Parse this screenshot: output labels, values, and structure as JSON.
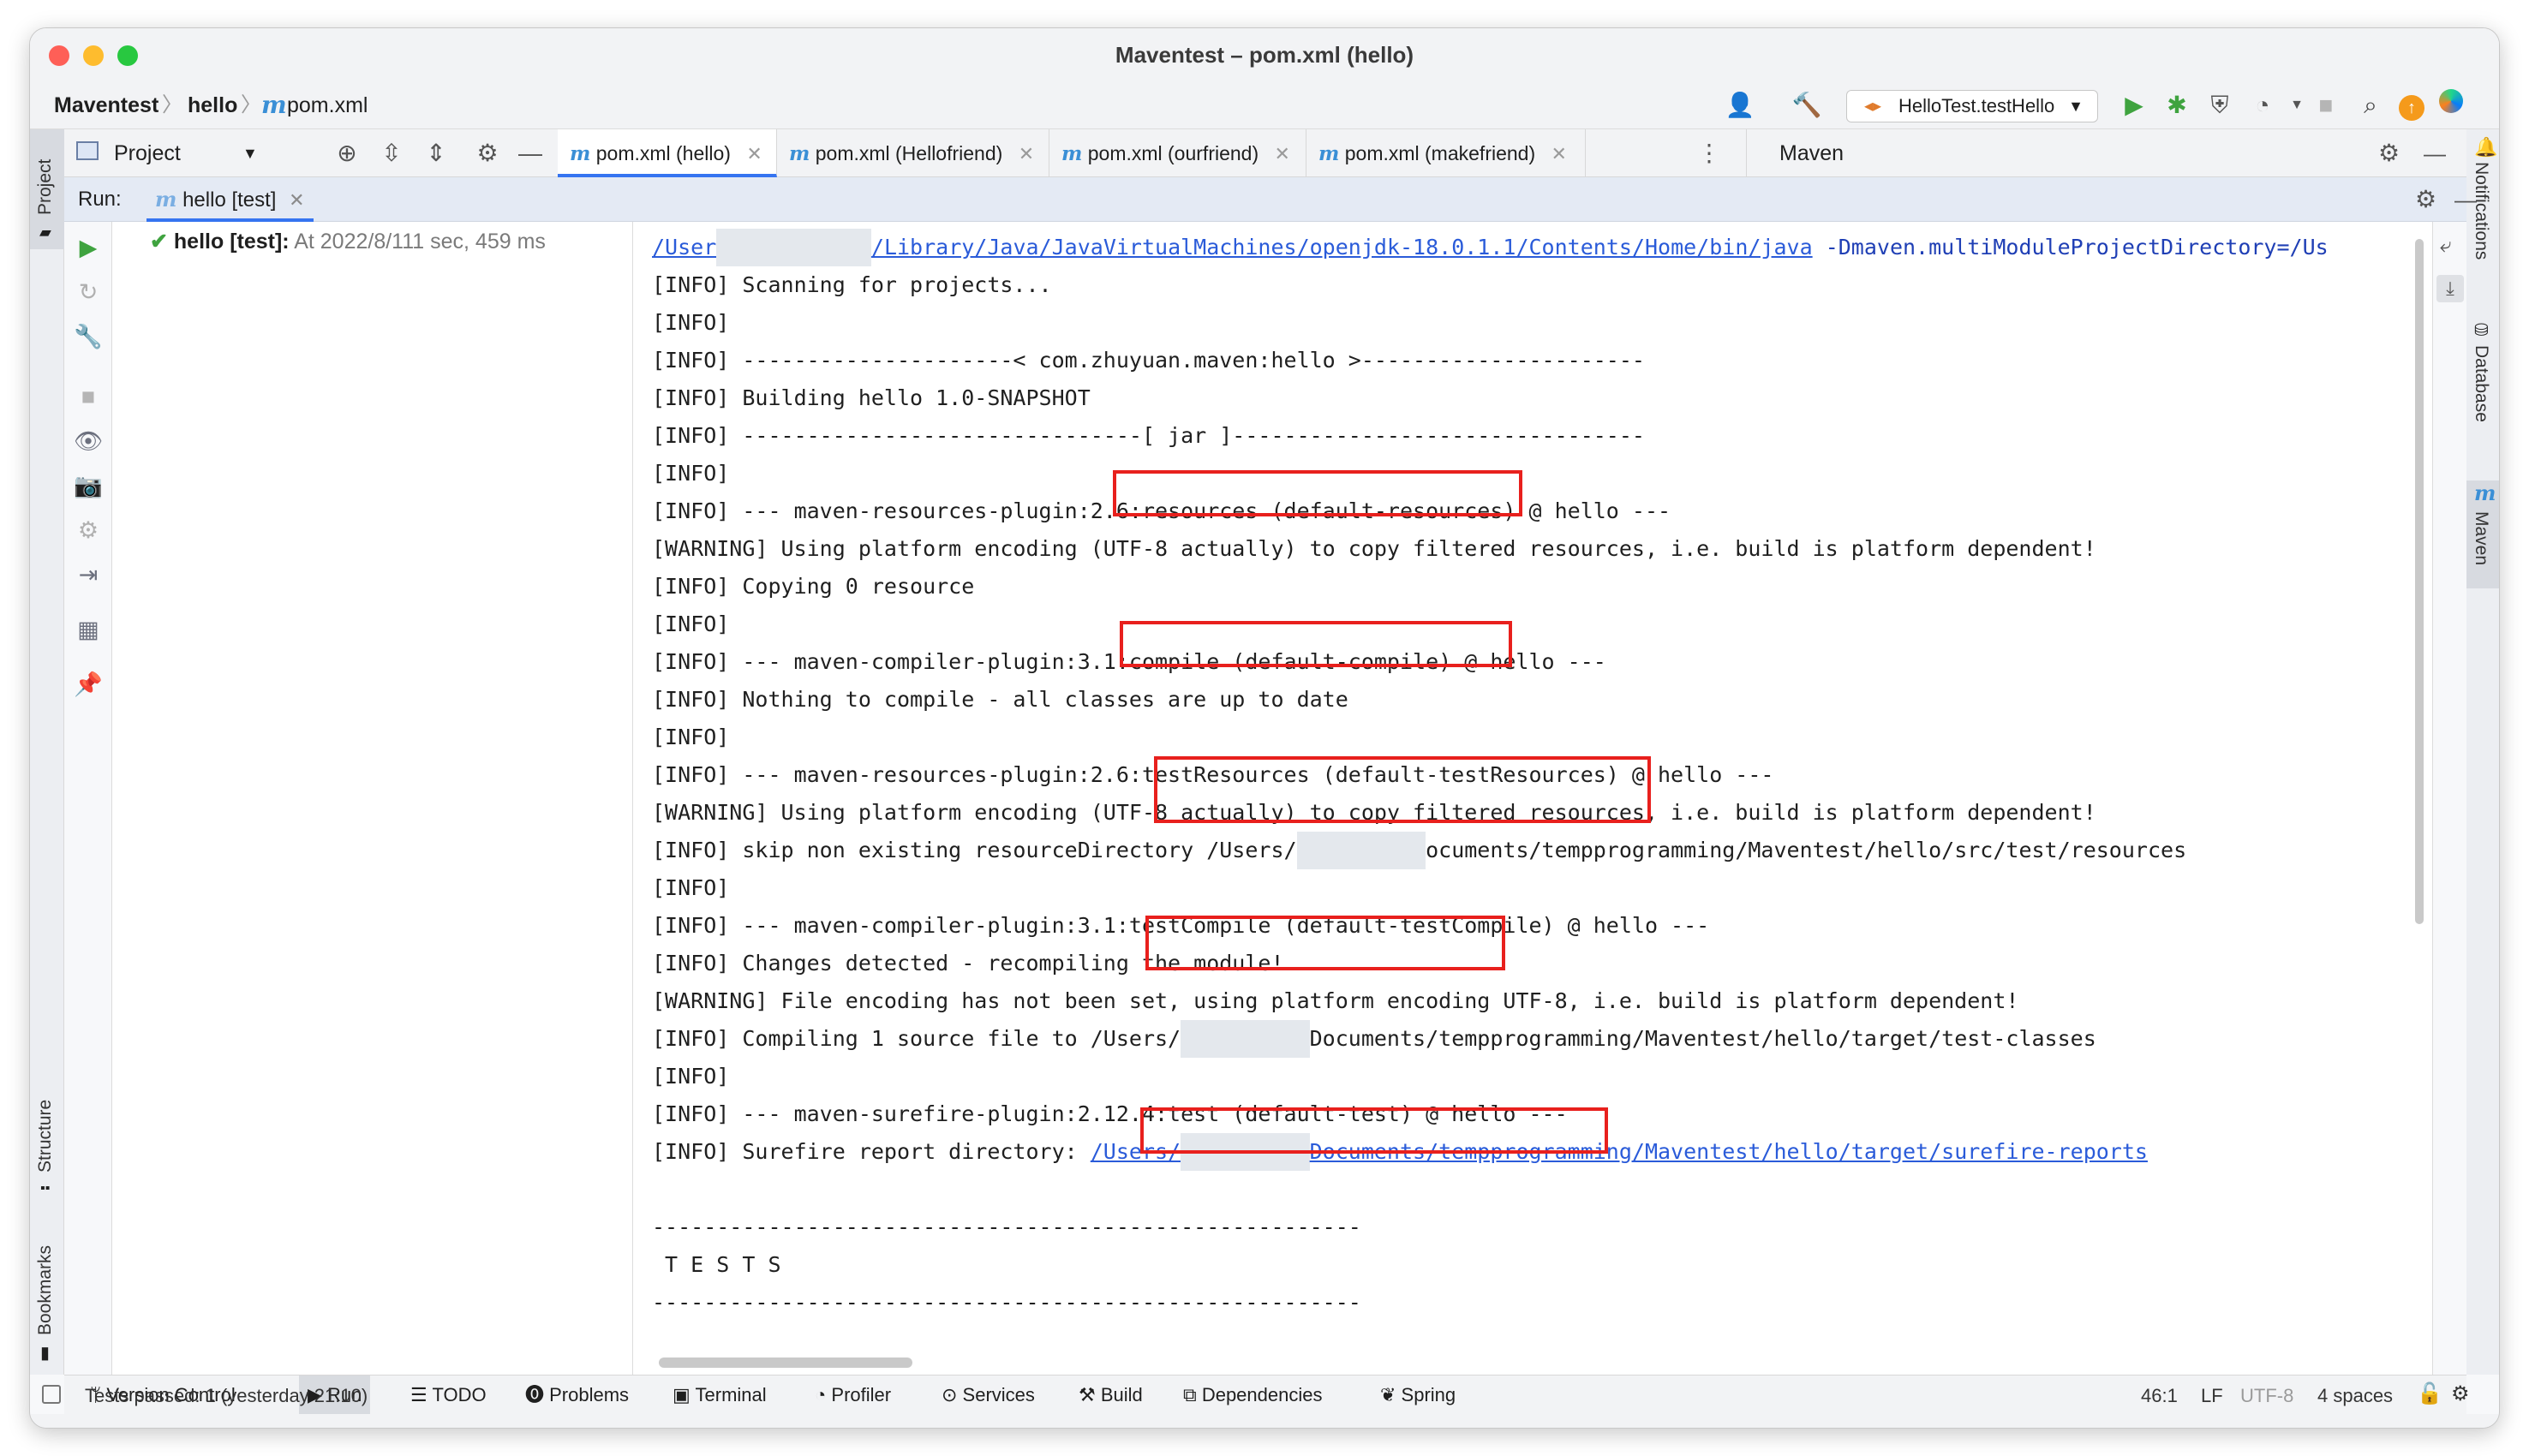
{
  "window": {
    "title": "Maventest – pom.xml (hello)"
  },
  "breadcrumb": {
    "project": "Maventest",
    "module": "hello",
    "file_icon": "m",
    "file": "pom.xml"
  },
  "toolbar": {
    "run_config": "HelloTest.testHello"
  },
  "left_strip": {
    "project": "Project",
    "structure": "Structure",
    "bookmarks": "Bookmarks"
  },
  "right_strip": {
    "notifications": "Notifications",
    "database": "Database",
    "maven": "Maven"
  },
  "project_panel": {
    "title": "Project"
  },
  "editor_tabs": [
    {
      "label": "pom.xml (hello)",
      "active": true
    },
    {
      "label": "pom.xml (Hellofriend)",
      "active": false
    },
    {
      "label": "pom.xml (ourfriend)",
      "active": false
    },
    {
      "label": "pom.xml (makefriend)",
      "active": false
    }
  ],
  "maven_panel": {
    "title": "Maven"
  },
  "run": {
    "label": "Run:",
    "tab": "hello [test]"
  },
  "test_tree": {
    "name": "hello [test]:",
    "meta": "At 2022/8/111 sec, 459 ms"
  },
  "console": {
    "lines": [
      {
        "type": "cmd",
        "a": "/User",
        "b": "/Library/Java/JavaVirtualMachines/openjdk-18.0.1.1/Contents/Home/bin/java",
        "c": " -Dmaven.multiModuleProjectDirectory=/Us"
      },
      {
        "type": "text",
        "text": "[INFO] Scanning for projects..."
      },
      {
        "type": "text",
        "text": "[INFO]"
      },
      {
        "type": "text",
        "text": "[INFO] ---------------------< com.zhuyuan.maven:hello >----------------------"
      },
      {
        "type": "text",
        "text": "[INFO] Building hello 1.0-SNAPSHOT"
      },
      {
        "type": "text",
        "text": "[INFO] -------------------------------[ jar ]--------------------------------"
      },
      {
        "type": "text",
        "text": "[INFO]"
      },
      {
        "type": "text",
        "text": "[INFO] --- maven-resources-plugin:2.6:resources (default-resources) @ hello ---"
      },
      {
        "type": "text",
        "text": "[WARNING] Using platform encoding (UTF-8 actually) to copy filtered resources, i.e. build is platform dependent!"
      },
      {
        "type": "text",
        "text": "[INFO] Copying 0 resource"
      },
      {
        "type": "text",
        "text": "[INFO]"
      },
      {
        "type": "text",
        "text": "[INFO] --- maven-compiler-plugin:3.1:compile (default-compile) @ hello ---"
      },
      {
        "type": "text",
        "text": "[INFO] Nothing to compile - all classes are up to date"
      },
      {
        "type": "text",
        "text": "[INFO]"
      },
      {
        "type": "text",
        "text": "[INFO] --- maven-resources-plugin:2.6:testResources (default-testResources) @ hello ---"
      },
      {
        "type": "text",
        "text": "[WARNING] Using platform encoding (UTF-8 actually) to copy filtered resources, i.e. build is platform dependent!"
      },
      {
        "type": "masked",
        "a": "[INFO] skip non existing resourceDirectory /Users/",
        "b": "ocuments/tempprogramming/Maventest/hello/src/test/resources"
      },
      {
        "type": "text",
        "text": "[INFO]"
      },
      {
        "type": "text",
        "text": "[INFO] --- maven-compiler-plugin:3.1:testCompile (default-testCompile) @ hello ---"
      },
      {
        "type": "text",
        "text": "[INFO] Changes detected - recompiling the module!"
      },
      {
        "type": "text",
        "text": "[WARNING] File encoding has not been set, using platform encoding UTF-8, i.e. build is platform dependent!"
      },
      {
        "type": "masked",
        "a": "[INFO] Compiling 1 source file to /Users/",
        "b": "Documents/tempprogramming/Maventest/hello/target/test-classes"
      },
      {
        "type": "text",
        "text": "[INFO]"
      },
      {
        "type": "text",
        "text": "[INFO] --- maven-surefire-plugin:2.12.4:test (default-test) @ hello ---"
      },
      {
        "type": "link",
        "a": "[INFO] Surefire report directory: ",
        "b": "/Users/",
        "c": "Documents/tempprogramming/Maventest/hello/target/surefire-reports"
      },
      {
        "type": "text",
        "text": ""
      },
      {
        "type": "text",
        "text": "-------------------------------------------------------"
      },
      {
        "type": "text",
        "text": " T E S T S"
      },
      {
        "type": "text",
        "text": "-------------------------------------------------------"
      }
    ]
  },
  "bottom_tabs": [
    {
      "icon": "branch-icon",
      "label": "Version Control"
    },
    {
      "icon": "play-icon",
      "label": "Run"
    },
    {
      "icon": "list-icon",
      "label": "TODO"
    },
    {
      "icon": "alert-icon",
      "label": "Problems"
    },
    {
      "icon": "terminal-icon",
      "label": "Terminal"
    },
    {
      "icon": "profiler-icon",
      "label": "Profiler"
    },
    {
      "icon": "services-icon",
      "label": "Services"
    },
    {
      "icon": "hammer-icon",
      "label": "Build"
    },
    {
      "icon": "layers-icon",
      "label": "Dependencies"
    },
    {
      "icon": "leaf-icon",
      "label": "Spring"
    }
  ],
  "status": {
    "message": "Tests passed: 1 (yesterday 21:10)",
    "position": "46:1",
    "line_sep": "LF",
    "encoding": "UTF-8",
    "indent": "4 spaces"
  },
  "colors": {
    "accent": "#3574f0",
    "highlight_box": "#e8201d",
    "run_green": "#3fa33f",
    "maven_blue": "#3a8fd6"
  }
}
